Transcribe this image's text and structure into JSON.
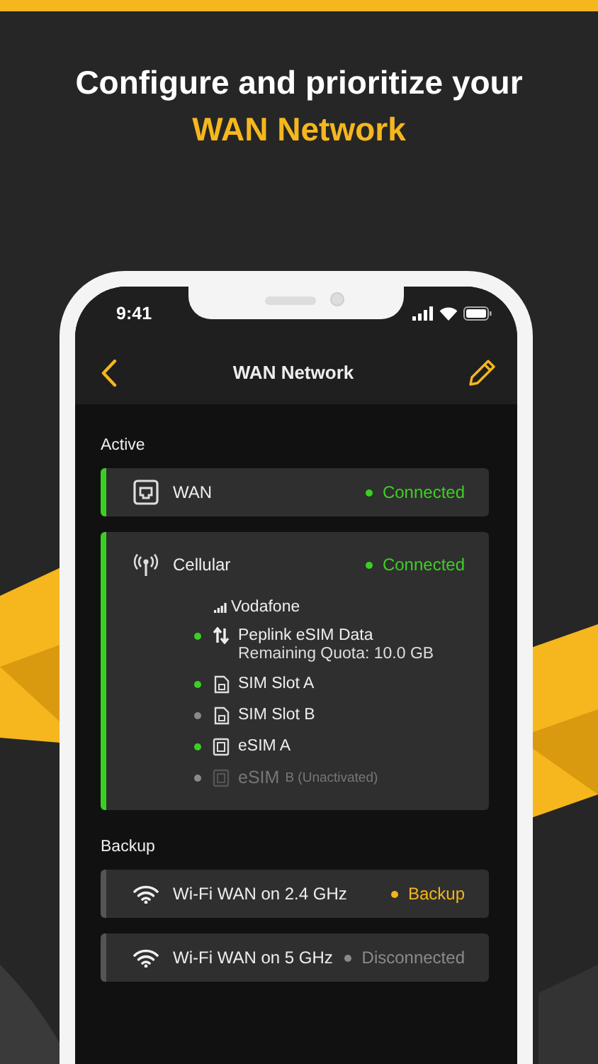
{
  "headline": [
    {
      "text": "Configure and prioritize your",
      "highlight": false
    },
    {
      "text": "WAN Network",
      "highlight": true
    }
  ],
  "status_bar": {
    "time": "9:41"
  },
  "nav": {
    "title": "WAN Network"
  },
  "sections": [
    {
      "title": "Active",
      "items": [
        {
          "kind": "wan",
          "name": "WAN",
          "status": "Connected",
          "color": "#3ccf23",
          "active": true
        },
        {
          "kind": "cellular",
          "name": "Cellular",
          "status": "Connected",
          "color": "#3ccf23",
          "active": true,
          "carrier": "Vodafone",
          "sims": [
            {
              "kind": "data",
              "name": "Peplink eSIM Data",
              "detail": "Remaining Quota: 10.0 GB",
              "on": true,
              "disabled": false
            },
            {
              "kind": "sim",
              "name": "SIM Slot A",
              "on": true,
              "disabled": false
            },
            {
              "kind": "sim",
              "name": "SIM Slot B",
              "on": false,
              "disabled": false
            },
            {
              "kind": "esim",
              "name": "eSIM A",
              "on": true,
              "disabled": false
            },
            {
              "kind": "esim",
              "name": "eSIM",
              "note": "B (Unactivated)",
              "on": false,
              "disabled": true
            }
          ]
        }
      ]
    },
    {
      "title": "Backup",
      "items": [
        {
          "kind": "wifi",
          "name": "Wi-Fi WAN on 2.4 GHz",
          "status": "Backup",
          "color": "#f2b51c",
          "active": false
        },
        {
          "kind": "wifi",
          "name": "Wi-Fi WAN on 5 GHz",
          "status": "Disconnected",
          "color": "#8a8a8a",
          "active": false
        }
      ]
    }
  ]
}
